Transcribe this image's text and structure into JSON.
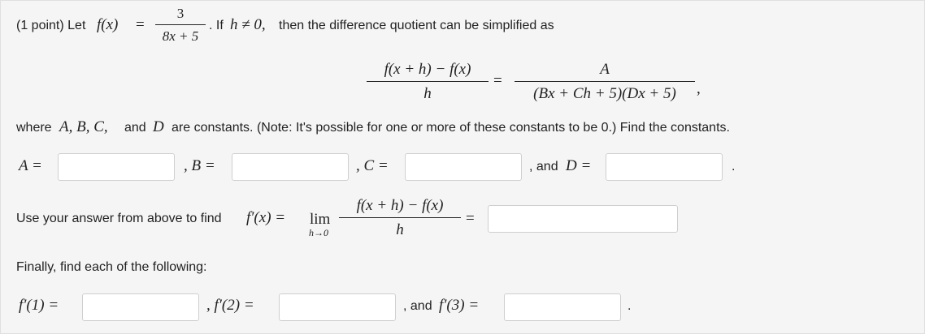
{
  "intro": {
    "prefix": "(1 point) Let",
    "f_of_x": "f(x)",
    "equals": "=",
    "def_num": "3",
    "def_den": "8x + 5",
    "after_def": ". If",
    "cond": "h ≠ 0,",
    "after_cond": "then the difference quotient can be simplified as"
  },
  "dq": {
    "num": "f(x + h) − f(x)",
    "den": "h",
    "equals": "=",
    "rhs_num": "A",
    "rhs_den": "(Bx + Ch + 5)(Dx + 5)",
    "comma": ","
  },
  "where": {
    "text1": "where",
    "consts": "A, B, C,",
    "text_and": "and",
    "const_d": "D",
    "text2": "are constants. (Note: It's possible for one or more of these constants to be 0.) Find the constants."
  },
  "constants_row": {
    "a_label": "A =",
    "b_label": ", B =",
    "c_label": ", C =",
    "and_text": ", and",
    "d_label": "D =",
    "end": "."
  },
  "derivative": {
    "text": "Use your answer from above to find",
    "fprime": "f′(x) =",
    "lim": "lim",
    "lim_sub": "h→0",
    "num": "f(x + h) − f(x)",
    "den": "h",
    "equals": "="
  },
  "finally": {
    "text": "Finally, find each of the following:"
  },
  "values_row": {
    "f1_label": "f′(1) =",
    "f2_label": ", f′(2) =",
    "and_text": ", and",
    "f3_label": "f′(3) =",
    "end": "."
  },
  "inputs": {
    "A": "",
    "B": "",
    "C": "",
    "D": "",
    "fprime": "",
    "f1": "",
    "f2": "",
    "f3": ""
  }
}
